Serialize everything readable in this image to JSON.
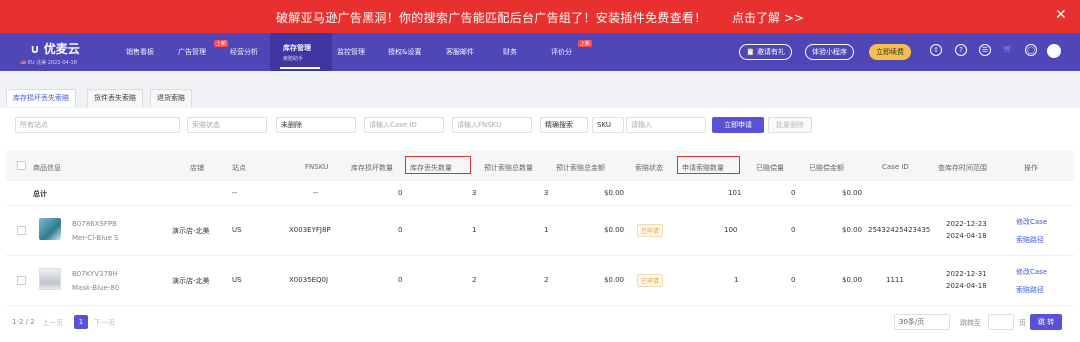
{
  "banner": {
    "message": "破解亚马逊广告黑洞！你的搜索广告能匹配后台广告组了！安装插件免费查看！",
    "cta": "点击了解 >>",
    "close": "✕"
  },
  "nav": {
    "logo": "优麦云",
    "sub_info": "🇺🇸 EU 北美 2022-04-18",
    "menus": [
      "销售看板",
      "广告管理",
      "经营分析",
      "库存管理",
      "监控管理",
      "授权&设置",
      "客服邮件",
      "财务",
      "评价分"
    ],
    "active_sub": "索赔助手",
    "badge": "上新",
    "pills": [
      "📋 邀请有礼",
      "体验小程序",
      "立即续费"
    ],
    "icons": [
      "⇧",
      "?",
      "☰",
      "🛒",
      "◯"
    ]
  },
  "tabs": [
    "库存损坏丢失索赔",
    "货件丢失索赔",
    "退货索赔"
  ],
  "filters": {
    "site": "所有站点",
    "status": "索赔状态",
    "deleted": "未删除",
    "case_placeholder": "请输入Case ID",
    "fnsku_placeholder": "请输入FNSKU",
    "match": "精确搜索",
    "sku": "SKU",
    "sku_placeholder": "请输入",
    "apply": "立即申请",
    "batch": "批量删除"
  },
  "columns": [
    "商品信息",
    "店铺",
    "站点",
    "FNSKU",
    "库存损坏数量",
    "库存丢失数量",
    "预计索赔总数量",
    "预计索赔总金额",
    "索赔状态",
    "申请索赔数量",
    "已赔偿量",
    "已赔偿金额",
    "Case ID",
    "查库存时间范围",
    "操作"
  ],
  "total": {
    "label": "总计",
    "site": "--",
    "fnsku": "--",
    "damaged": "0",
    "lost": "3",
    "est_qty": "3",
    "est_amt": "$0.00",
    "apply": "101",
    "paid_qty": "0",
    "paid_amt": "$0.00"
  },
  "rows": [
    {
      "asin": "B0786XSFPB",
      "sku": "Mer-Cl-Blue S",
      "shop": "演示店-北美",
      "site": "US",
      "fnsku": "X003EYFJ8P",
      "damaged": "0",
      "lost": "1",
      "est_qty": "1",
      "est_amt": "$0.00",
      "status": "已申请",
      "apply": "100",
      "paid_qty": "0",
      "paid_amt": "$0.00",
      "case_id": "25432425423435",
      "date_from": "2022-12-23",
      "date_to": "2024-04-18",
      "action1": "修改Case",
      "action2": "索赔路径"
    },
    {
      "asin": "B07KYV378H",
      "sku": "Mask-Blue-80",
      "shop": "演示店-北美",
      "site": "US",
      "fnsku": "X0035EQ0J",
      "damaged": "0",
      "lost": "2",
      "est_qty": "2",
      "est_amt": "$0.00",
      "status": "已申请",
      "apply": "1",
      "paid_qty": "0",
      "paid_amt": "$0.00",
      "case_id": "1111",
      "date_from": "2022-12-31",
      "date_to": "2024-04-18",
      "action1": "修改Case",
      "action2": "索赔路径"
    }
  ],
  "pager": {
    "range": "1-2 / 2",
    "prev": "上一页",
    "page": "1",
    "next": "下一页",
    "per_page": "30条/页",
    "jump_label": "跳转至",
    "unit": "页",
    "go": "跳 转"
  }
}
